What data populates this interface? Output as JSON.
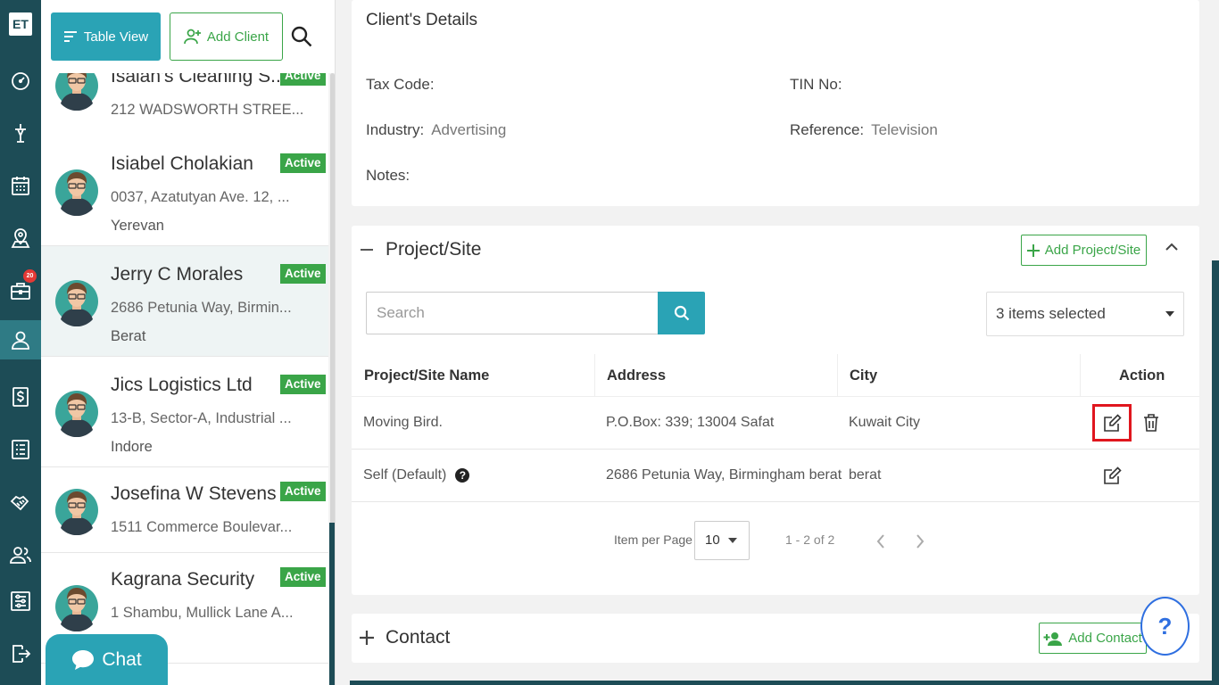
{
  "rail": {
    "logo": "ET",
    "badge_count": "20",
    "items": [
      "dashboard-icon",
      "funnel-icon",
      "calendar-icon",
      "map-pin-icon",
      "briefcase-icon",
      "user-icon",
      "dollar-icon",
      "list-icon",
      "handshake-icon",
      "users-icon",
      "settings-sliders-icon",
      "logout-icon"
    ]
  },
  "list_header": {
    "table_view_label": "Table View",
    "add_client_label": "Add Client"
  },
  "clients": [
    {
      "name": "Isaiah's Cleaning S...",
      "address": "212 WADSWORTH STREE...",
      "city": "",
      "status": "Active"
    },
    {
      "name": "Isiabel  Cholakian",
      "address": "0037, Azatutyan Ave. 12, ...",
      "city": "Yerevan",
      "status": "Active"
    },
    {
      "name": "Jerry C Morales",
      "address": "2686 Petunia Way, Birmin...",
      "city": "Berat",
      "status": "Active"
    },
    {
      "name": "Jics Logistics Ltd",
      "address": "13-B, Sector-A, Industrial ...",
      "city": "Indore",
      "status": "Active"
    },
    {
      "name": "Josefina W Stevens",
      "address": "1511 Commerce Boulevar...",
      "city": "",
      "status": "Active"
    },
    {
      "name": "Kagrana Security",
      "address": "1 Shambu, Mullick Lane A...",
      "city": "",
      "status": "Active"
    }
  ],
  "chat": {
    "label": "Chat"
  },
  "details": {
    "title": "Client's Details",
    "tax_code_label": "Tax Code:",
    "tax_code_value": "",
    "tin_label": "TIN No:",
    "tin_value": "",
    "industry_label": "Industry:",
    "industry_value": "Advertising",
    "reference_label": "Reference:",
    "reference_value": "Television",
    "notes_label": "Notes:",
    "notes_value": ""
  },
  "project": {
    "title": "Project/Site",
    "add_label": "Add Project/Site",
    "search_placeholder": "Search",
    "columns_selected": "3 items selected",
    "headers": [
      "Project/Site Name",
      "Address",
      "City",
      "Action"
    ],
    "rows": [
      {
        "name": "Moving Bird.",
        "address": "P.O.Box: 339; 13004 Safat",
        "city": "Kuwait City",
        "default": false
      },
      {
        "name": "Self (Default)",
        "address": "2686 Petunia Way, Birmingham berat",
        "city": "berat",
        "default": true
      }
    ],
    "help_mark": "?",
    "pager": {
      "items_per_page_label": "Item per Page",
      "items_per_page": "10",
      "range": "1 - 2 of 2"
    }
  },
  "contact": {
    "title": "Contact",
    "add_label": "Add Contact"
  },
  "help_fab": {
    "label": "?"
  },
  "colors": {
    "rail": "#1d4c56",
    "accent_teal": "#2aa3b5",
    "green": "#3aa548",
    "highlight_red": "#e0161e",
    "help_blue": "#2f6fe0"
  }
}
